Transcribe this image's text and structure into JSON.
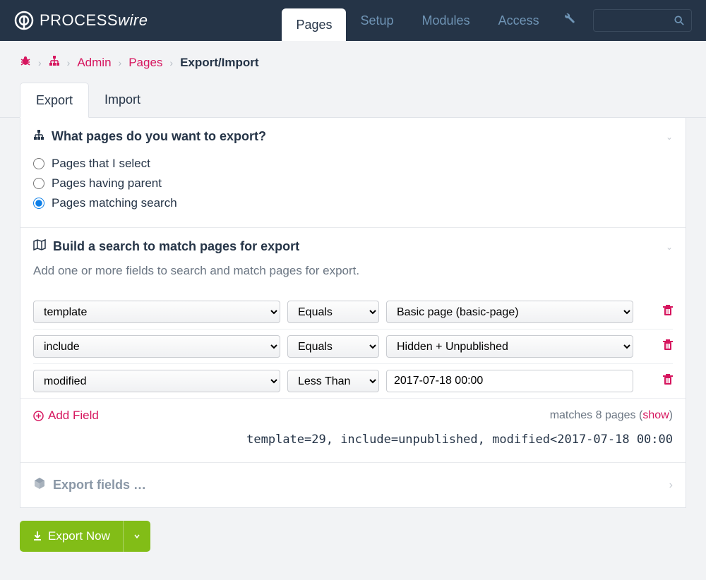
{
  "logo": {
    "text1": "PROCESS",
    "text2": "wire"
  },
  "nav": {
    "pages": "Pages",
    "setup": "Setup",
    "modules": "Modules",
    "access": "Access"
  },
  "breadcrumb": {
    "admin": "Admin",
    "pages": "Pages",
    "current": "Export/Import"
  },
  "tabs": {
    "export": "Export",
    "import": "Import"
  },
  "section1": {
    "title": "What pages do you want to export?",
    "options": {
      "select": "Pages that I select",
      "parent": "Pages having parent",
      "search": "Pages matching search"
    }
  },
  "section2": {
    "title": "Build a search to match pages for export",
    "desc": "Add one or more fields to search and match pages for export.",
    "rows": [
      {
        "field": "template",
        "op": "Equals",
        "value": "Basic page (basic-page)"
      },
      {
        "field": "include",
        "op": "Equals",
        "value": "Hidden + Unpublished"
      },
      {
        "field": "modified",
        "op": "Less Than",
        "value": "2017-07-18 00:00"
      }
    ],
    "add_field": "Add Field",
    "matches_prefix": "matches 8 pages (",
    "matches_show": "show",
    "matches_suffix": ")",
    "selector": "template=29, include=unpublished, modified<2017-07-18 00:00"
  },
  "section3": {
    "title": "Export fields …"
  },
  "actions": {
    "export_now": "Export Now"
  }
}
